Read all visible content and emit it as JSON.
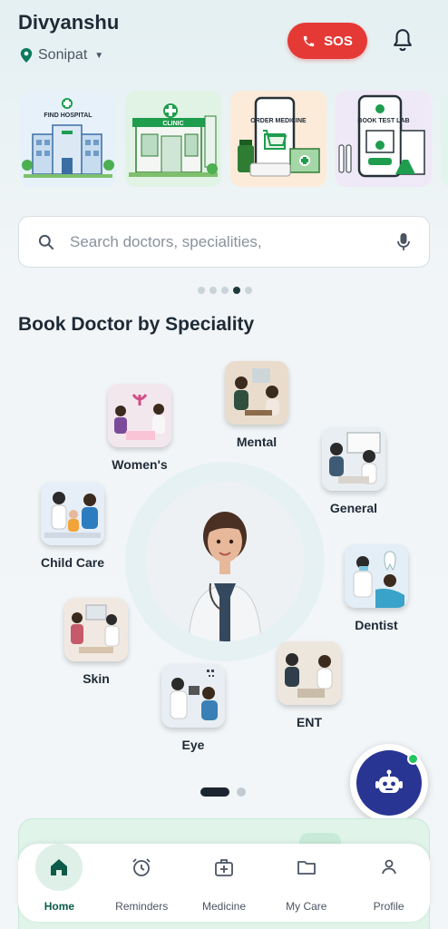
{
  "header": {
    "user_name": "Divyanshu",
    "location": "Sonipat",
    "sos_label": "SOS"
  },
  "banners": [
    {
      "label": "FIND HOSPITAL",
      "icon": "hospital-icon"
    },
    {
      "label": "CLINIC",
      "icon": "clinic-icon"
    },
    {
      "label": "ORDER MEDICINE",
      "icon": "medicine-icon"
    },
    {
      "label": "BOOK TEST LAB",
      "icon": "lab-icon"
    }
  ],
  "search": {
    "placeholder": "Search doctors, specialities,"
  },
  "carousel": {
    "count": 5,
    "active_index": 3
  },
  "section_title": "Book Doctor by Speciality",
  "specialities": [
    {
      "label": "Mental"
    },
    {
      "label": "Women's"
    },
    {
      "label": "General"
    },
    {
      "label": "Child Care"
    },
    {
      "label": "Dentist"
    },
    {
      "label": "Skin"
    },
    {
      "label": "ENT"
    },
    {
      "label": "Eye"
    }
  ],
  "nav": {
    "items": [
      {
        "label": "Home",
        "icon": "home-icon",
        "active": true
      },
      {
        "label": "Reminders",
        "icon": "alarm-icon",
        "active": false
      },
      {
        "label": "Medicine",
        "icon": "medical-kit-icon",
        "active": false
      },
      {
        "label": "My Care",
        "icon": "folder-icon",
        "active": false
      },
      {
        "label": "Profile",
        "icon": "person-icon",
        "active": false
      }
    ]
  },
  "colors": {
    "sos": "#e53935",
    "primary_green": "#0d5b4a",
    "bot": "#283593",
    "online": "#22c55e"
  }
}
